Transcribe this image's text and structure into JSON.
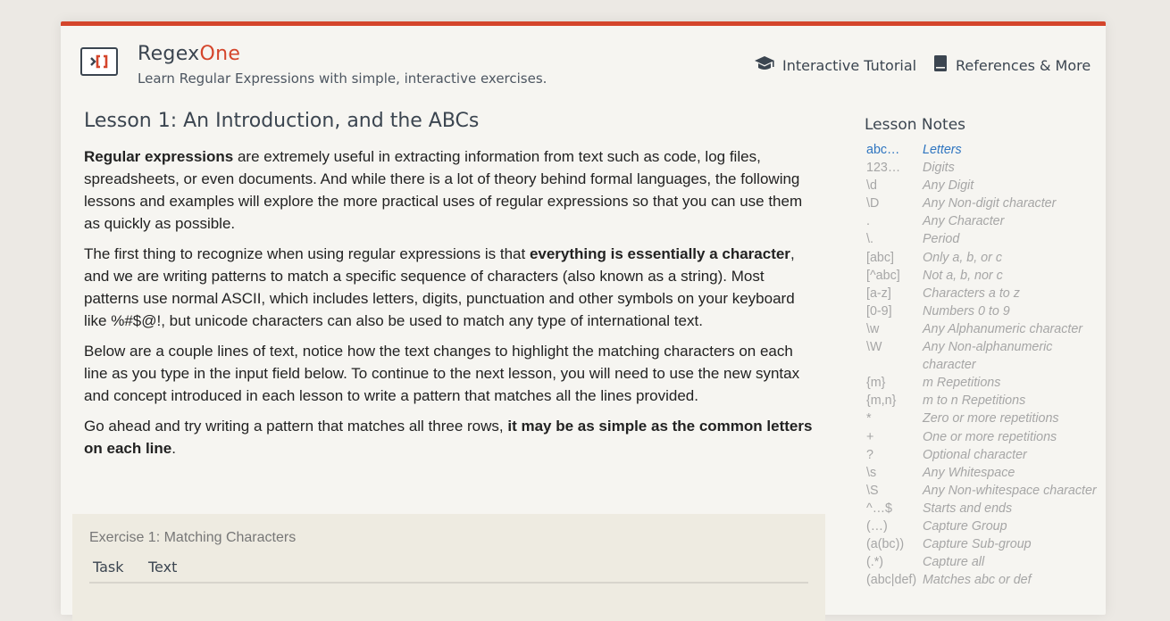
{
  "header": {
    "brand_main": "Regex",
    "brand_accent": "One",
    "tagline": "Learn Regular Expressions with simple, interactive exercises.",
    "nav": [
      {
        "label": "Interactive Tutorial",
        "icon": "graduation-cap-icon"
      },
      {
        "label": "References & More",
        "icon": "book-icon"
      }
    ]
  },
  "lesson": {
    "title": "Lesson 1: An Introduction, and the ABCs",
    "p1": {
      "bold": "Regular expressions",
      "text": " are extremely useful in extracting information from text such as code, log files, spreadsheets, or even documents. And while there is a lot of theory behind formal languages, the following lessons and examples will explore the more practical uses of regular expressions so that you can use them as quickly as possible."
    },
    "p2": {
      "text_a": "The first thing to recognize when using regular expressions is that ",
      "bold": "everything is essentially a character",
      "text_b": ", and we are writing patterns to match a specific sequence of characters (also known as a string). Most patterns use normal ASCII, which includes letters, digits, punctuation and other symbols on your keyboard like %#$@!, but unicode characters can also be used to match any type of international text."
    },
    "p3": "Below are a couple lines of text, notice how the text changes to highlight the matching characters on each line as you type in the input field below. To continue to the next lesson, you will need to use the new syntax and concept introduced in each lesson to write a pattern that matches all the lines provided.",
    "p4": {
      "text": "Go ahead and try writing a pattern that matches all three rows, ",
      "bold": "it may be as simple as the common letters on each line",
      "end": "."
    }
  },
  "exercise": {
    "title": "Exercise 1: Matching Characters",
    "col_task": "Task",
    "col_text": "Text"
  },
  "notes": {
    "title": "Lesson Notes",
    "items": [
      {
        "sym": "abc…",
        "desc": "Letters",
        "active": true
      },
      {
        "sym": "123…",
        "desc": "Digits"
      },
      {
        "sym": "\\d",
        "desc": "Any Digit"
      },
      {
        "sym": "\\D",
        "desc": "Any Non-digit character"
      },
      {
        "sym": ".",
        "desc": "Any Character"
      },
      {
        "sym": "\\.",
        "desc": "Period"
      },
      {
        "sym": "[abc]",
        "desc": "Only a, b, or c"
      },
      {
        "sym": "[^abc]",
        "desc": "Not a, b, nor c"
      },
      {
        "sym": "[a-z]",
        "desc": "Characters a to z"
      },
      {
        "sym": "[0-9]",
        "desc": "Numbers 0 to 9"
      },
      {
        "sym": "\\w",
        "desc": "Any Alphanumeric character"
      },
      {
        "sym": "\\W",
        "desc": "Any Non-alphanumeric character"
      },
      {
        "sym": "{m}",
        "desc": "m Repetitions"
      },
      {
        "sym": "{m,n}",
        "desc": "m to n Repetitions"
      },
      {
        "sym": "*",
        "desc": "Zero or more repetitions"
      },
      {
        "sym": "+",
        "desc": "One or more repetitions"
      },
      {
        "sym": "?",
        "desc": "Optional character"
      },
      {
        "sym": "\\s",
        "desc": "Any Whitespace"
      },
      {
        "sym": "\\S",
        "desc": "Any Non-whitespace character"
      },
      {
        "sym": "^…$",
        "desc": "Starts and ends"
      },
      {
        "sym": "(…)",
        "desc": "Capture Group"
      },
      {
        "sym": "(a(bc))",
        "desc": "Capture Sub-group"
      },
      {
        "sym": "(.*)",
        "desc": "Capture all"
      },
      {
        "sym": "(abc|def)",
        "desc": "Matches abc or def"
      }
    ]
  },
  "colors": {
    "accent": "#d4452b",
    "link": "#2f75c0",
    "text": "#3b4550"
  }
}
